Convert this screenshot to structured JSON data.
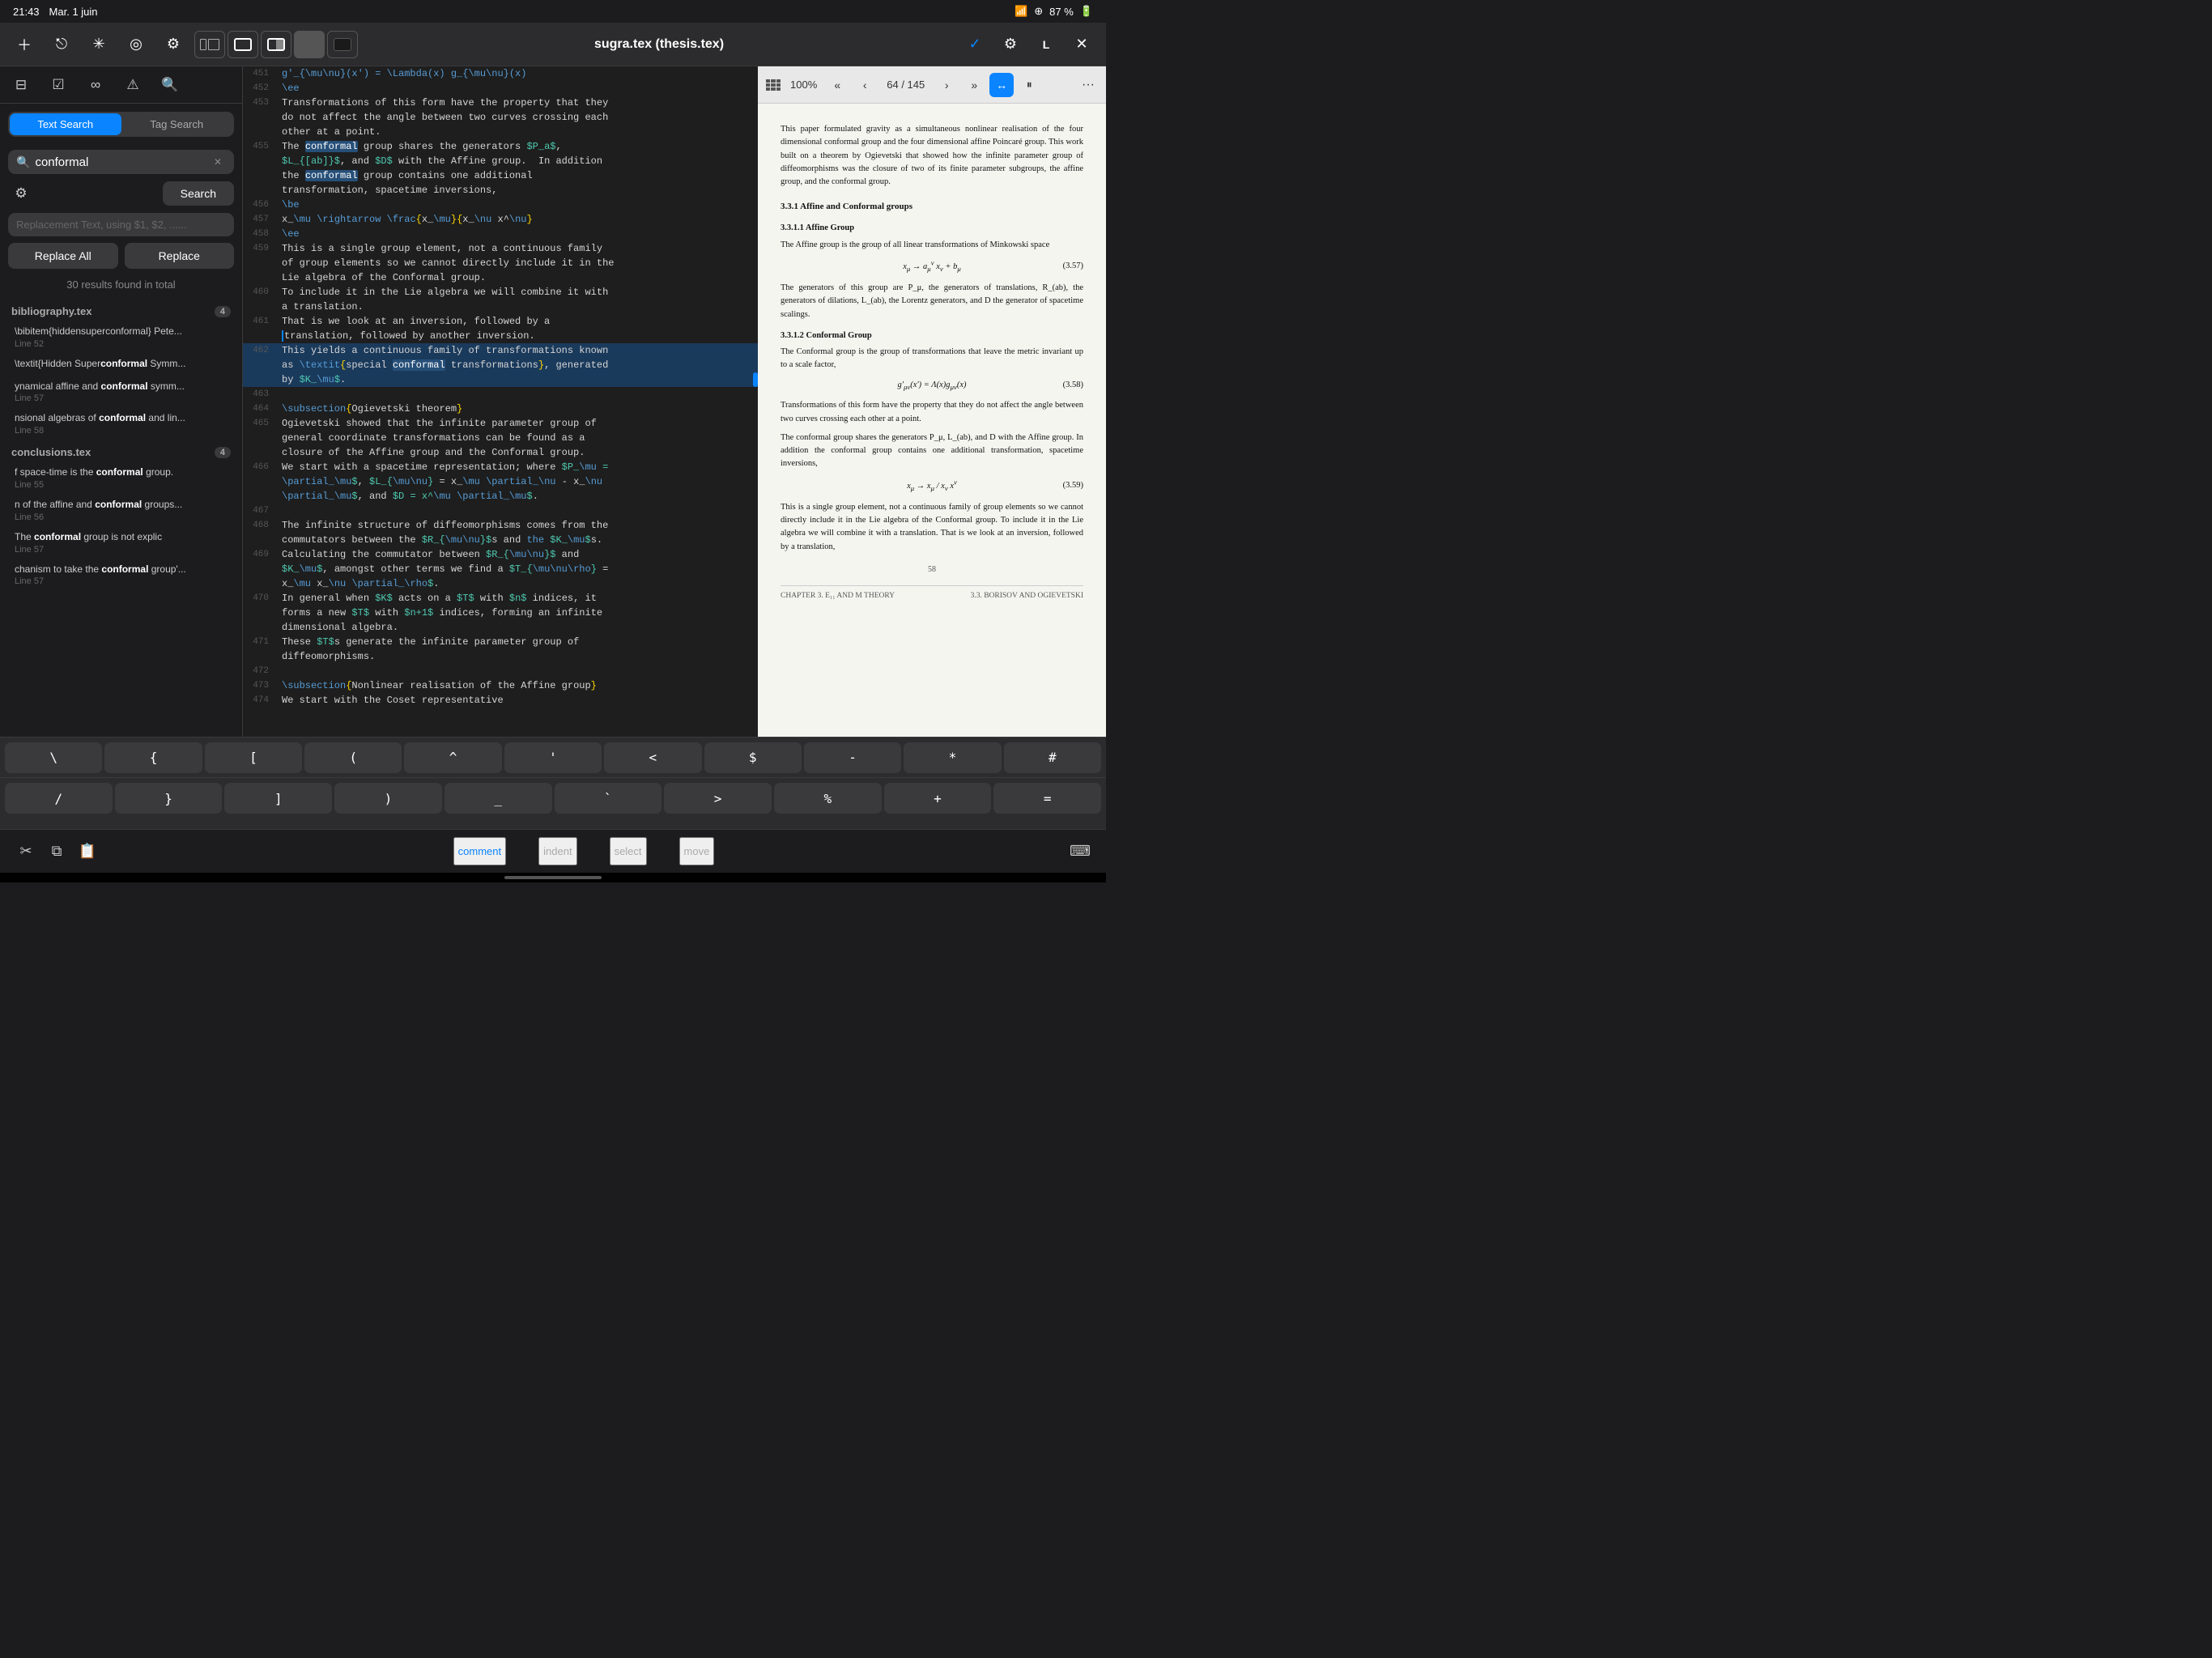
{
  "statusBar": {
    "time": "21:43",
    "date": "Mar. 1 juin",
    "wifi": "WiFi",
    "signal": "●",
    "battery": "87 %"
  },
  "toolbar": {
    "title": "sugra.tex (thesis.tex)",
    "shapes": [
      "outline",
      "half",
      "dark",
      "black"
    ],
    "rightIcons": [
      "checkmark-circle",
      "gear",
      "L",
      "close"
    ]
  },
  "leftPanel": {
    "icons": [
      "sidebar",
      "checkbox",
      "infinity",
      "warning",
      "search"
    ],
    "tabs": [
      "Text Search",
      "Tag Search"
    ],
    "activeTab": 0,
    "searchValue": "conformal",
    "searchPlaceholder": "conformal",
    "replacePlaceholder": "Replacement Text, using $1, $2, ......",
    "searchLabel": "Search",
    "replaceAllLabel": "Replace All",
    "replaceLabel": "Replace",
    "resultsCount": "30 results found in total",
    "files": [
      {
        "name": "bibliography.tex",
        "count": 4,
        "results": [
          {
            "text": "\\bibitem{hiddensuperconformal} Pete...",
            "bold": "conformal",
            "line": "Line 52"
          },
          {
            "text": "\\textit{Hidden Superconformal Symm...",
            "bold": "conformal",
            "line": ""
          },
          {
            "text": "ynamical affine and conformal symm...",
            "bold": "conformal",
            "line": "Line 57"
          },
          {
            "text": "nsional algebras of conformal and lin...",
            "bold": "conformal",
            "line": "Line 58"
          }
        ]
      },
      {
        "name": "conclusions.tex",
        "count": 4,
        "results": [
          {
            "text": "f space-time is the conformal group.",
            "bold": "conformal",
            "line": "Line 55"
          },
          {
            "text": "n of the affine and conformal groups...",
            "bold": "conformal",
            "line": "Line 56"
          },
          {
            "text": "The conformal group is not explic",
            "bold": "conformal",
            "line": "Line 57"
          },
          {
            "text": "chanism to take the conformal group'...",
            "bold": "conformal",
            "line": "Line 57"
          }
        ]
      }
    ]
  },
  "editor": {
    "lines": [
      {
        "num": 451,
        "content": "g'_{\\mu\\nu}(x') = \\Lambda(x) g_{\\mu\\nu}(x)",
        "highlight": false
      },
      {
        "num": 452,
        "content": "\\ee",
        "highlight": false,
        "isCmd": true
      },
      {
        "num": 453,
        "content": "Transformations of this form have the property that they",
        "highlight": false
      },
      {
        "num": "",
        "content": "do not affect the angle between two curves crossing each",
        "highlight": false
      },
      {
        "num": "",
        "content": "other at a point.",
        "highlight": false
      },
      {
        "num": 455,
        "content": "The conformal group shares the generators $P_a$,",
        "highlight": false
      },
      {
        "num": "",
        "content": "$L_{[ab]}$, and $D$ with the Affine group.  In addition",
        "highlight": false
      },
      {
        "num": "",
        "content": "the conformal group contains one additional",
        "highlight": false
      },
      {
        "num": "",
        "content": "transformation, spacetime inversions,",
        "highlight": false
      },
      {
        "num": 456,
        "content": "\\be",
        "highlight": false,
        "isCmd": true
      },
      {
        "num": 457,
        "content": "x_\\mu \\rightarrow \\frac{x_\\mu}{x_\\nu x^\\nu}",
        "highlight": false
      },
      {
        "num": 458,
        "content": "\\ee",
        "highlight": false,
        "isCmd": true
      },
      {
        "num": 459,
        "content": "This is a single group element, not a continuous family",
        "highlight": false
      },
      {
        "num": "",
        "content": "of group elements so we cannot directly include it in the",
        "highlight": false
      },
      {
        "num": "",
        "content": "Lie algebra of the Conformal group.",
        "highlight": false
      },
      {
        "num": 460,
        "content": "To include it in the Lie algebra we will combine it with",
        "highlight": false
      },
      {
        "num": "",
        "content": "a translation.",
        "highlight": false
      },
      {
        "num": 461,
        "content": "That is we look at an inversion, followed by a",
        "highlight": false
      },
      {
        "num": "",
        "content": "translation, followed by another inversion.",
        "highlight": false
      },
      {
        "num": 462,
        "content": "This yields a continuous family of transformations known",
        "highlight": true
      },
      {
        "num": "",
        "content": "as \\textit{special conformal transformations}, generated",
        "highlight": true
      },
      {
        "num": "",
        "content": "by $K_\\mu$.",
        "highlight": true
      },
      {
        "num": 463,
        "content": "",
        "highlight": false
      },
      {
        "num": 464,
        "content": "\\subsection{Ogievetski theorem}",
        "highlight": false,
        "isCmd": true
      },
      {
        "num": 465,
        "content": "Ogievetski showed that the infinite parameter group of",
        "highlight": false
      },
      {
        "num": "",
        "content": "general coordinate transformations can be found as a",
        "highlight": false
      },
      {
        "num": "",
        "content": "closure of the Affine group and the Conformal group.",
        "highlight": false
      },
      {
        "num": 466,
        "content": "We start with a spacetime representation; where $P_\\mu =",
        "highlight": false
      },
      {
        "num": "",
        "content": "\\partial_\\mu$, $L_{\\mu\\nu} = x_\\mu \\partial_\\nu - x_\\nu",
        "highlight": false
      },
      {
        "num": "",
        "content": "\\partial_\\mu$, and $D = x^\\mu \\partial_\\mu$.",
        "highlight": false
      },
      {
        "num": 467,
        "content": "",
        "highlight": false
      },
      {
        "num": 468,
        "content": "The infinite structure of diffeomorphisms comes from the",
        "highlight": false
      },
      {
        "num": "",
        "content": "commutators between the $R_{\\mu\\nu}$s and the $K_\\mu$s.",
        "highlight": false
      },
      {
        "num": 469,
        "content": "Calculating the commutator between $R_{\\mu\\nu}$ and",
        "highlight": false
      },
      {
        "num": "",
        "content": "$K_\\mu$, amongst other terms we find a $T_{\\mu\\nu\\rho} =",
        "highlight": false
      },
      {
        "num": "",
        "content": "x_\\mu x_\\nu \\partial_\\rho$.",
        "highlight": false
      },
      {
        "num": 470,
        "content": "In general when $K$ acts on a $T$ with $n$ indices, it",
        "highlight": false
      },
      {
        "num": "",
        "content": "forms a new $T$ with $n+1$ indices, forming an infinite",
        "highlight": false
      },
      {
        "num": "",
        "content": "dimensional algebra.",
        "highlight": false
      },
      {
        "num": 471,
        "content": "These $T$s generate the infinite parameter group of",
        "highlight": false
      },
      {
        "num": "",
        "content": "diffeomorphisms.",
        "highlight": false
      },
      {
        "num": 472,
        "content": "",
        "highlight": false
      },
      {
        "num": 473,
        "content": "\\subsection{Nonlinear realisation of the Affine group}",
        "highlight": false,
        "isCmd": true
      },
      {
        "num": 474,
        "content": "We start with the Coset representative",
        "highlight": false
      }
    ]
  },
  "preview": {
    "zoom": "100%",
    "pageInfo": "64 / 145",
    "content": {
      "topPara": "This paper formulated gravity as a simultaneous nonlinear realisation of the four dimensional conformal group and the four dimensional affine Poincaré group. This work built on a theorem by Ogievetski that showed how the infinite parameter group of diffeomorphisms was the closure of two of its finite parameter subgroups, the affine group, and the conformal group.",
      "sec311": "3.3.1  Affine and Conformal groups",
      "sec3311": "3.3.1.1  Affine Group",
      "para3311": "The Affine group is the group of all linear transformations of Minkowski space",
      "eq357": "x_μ → a_μ^ν x_ν + b_μ",
      "eqNum357": "(3.57)",
      "para357post": "The generators of this group are P_μ, the generators of translations, R_(ab), the generators of dilations, L_(ab), the Lorentz generators, and D the generator of spacetime scalings.",
      "sec3312": "3.3.1.2  Conformal Group",
      "para3312": "The Conformal group is the group of transformations that leave the metric invariant up to a scale factor,",
      "eq358": "g'_μν(x') = Λ(x)g_μν(x)",
      "eqNum358": "(3.58)",
      "para358post": "Transformations of this form have the property that they do not affect the angle between two curves crossing each other at a point.",
      "para358post2": "The conformal group shares the generators P_μ, L_(ab), and D with the Affine group. In addition the conformal group contains one additional transformation, spacetime inversions,",
      "eq359": "x_μ → x_μ / x_ν x^ν",
      "eqNum359": "(3.59)",
      "para359post": "This is a single group element, not a continuous family of group elements so we cannot directly include it in the Lie algebra of the Conformal group. To include it in the Lie algebra we will combine it with a translation. That is we look at an inversion, followed by a translation,",
      "pageNumber": "58",
      "chapterLeft": "CHAPTER 3.  E₁₁ AND M THEORY",
      "chapterRight": "3.3. BORISOV AND OGIEVETSKI"
    }
  },
  "keyboard": {
    "row1": [
      "\\",
      "{",
      "[",
      "(",
      "^",
      "'",
      "<",
      "$",
      "-",
      "*",
      "#"
    ],
    "row2": [
      "/",
      "}",
      "]",
      ")",
      "_",
      "`",
      ">",
      "%",
      "+",
      "="
    ]
  },
  "bottomTabs": [
    "comment",
    "indent",
    "select",
    "move"
  ],
  "bottomIcons": [
    "cut",
    "copy",
    "paste",
    "keyboard"
  ]
}
